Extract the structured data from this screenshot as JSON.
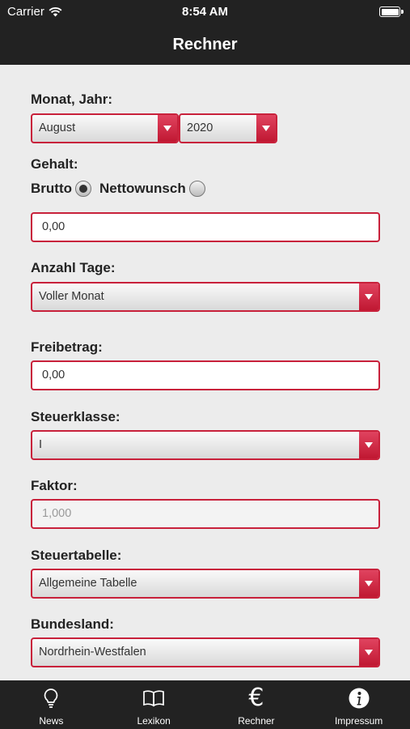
{
  "status": {
    "carrier": "Carrier",
    "time": "8:54 AM"
  },
  "nav": {
    "title": "Rechner"
  },
  "form": {
    "monat_jahr_label": "Monat, Jahr:",
    "month_value": "August",
    "year_value": "2020",
    "gehalt_label": "Gehalt:",
    "brutto_label": "Brutto",
    "netto_label": "Nettowunsch",
    "gehalt_value": "0,00",
    "anzahl_tage_label": "Anzahl Tage:",
    "anzahl_tage_value": "Voller Monat",
    "freibetrag_label": "Freibetrag:",
    "freibetrag_value": "0,00",
    "steuerklasse_label": "Steuerklasse:",
    "steuerklasse_value": "I",
    "faktor_label": "Faktor:",
    "faktor_placeholder": "1,000",
    "steuertabelle_label": "Steuertabelle:",
    "steuertabelle_value": "Allgemeine Tabelle",
    "bundesland_label": "Bundesland:",
    "bundesland_value": "Nordrhein-Westfalen"
  },
  "tabs": [
    {
      "label": "News",
      "icon": "lightbulb-icon"
    },
    {
      "label": "Lexikon",
      "icon": "book-icon"
    },
    {
      "label": "Rechner",
      "icon": "euro-icon"
    },
    {
      "label": "Impressum",
      "icon": "info-icon"
    }
  ],
  "colors": {
    "accent": "#c8213b",
    "bar": "#222222",
    "background": "#ececec"
  }
}
